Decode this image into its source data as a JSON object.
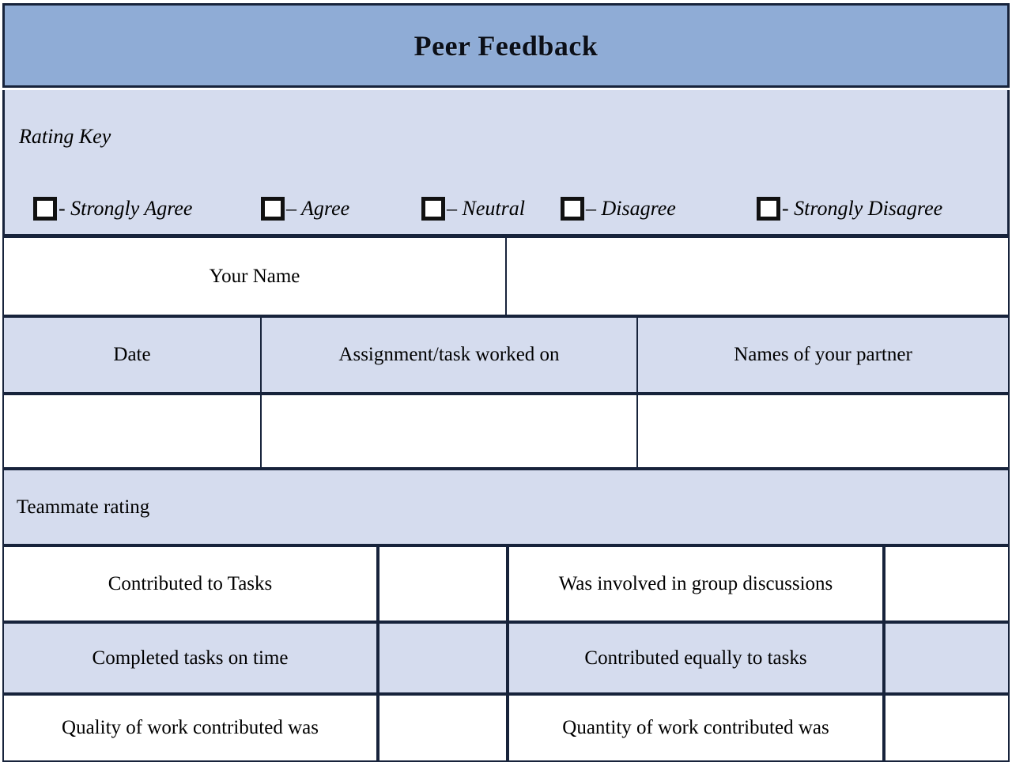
{
  "form": {
    "title": "Peer Feedback",
    "rating_key": {
      "heading": "Rating Key",
      "options": [
        {
          "checkbox": "checkbox-strongly-agree",
          "label": "- Strongly Agree"
        },
        {
          "checkbox": "checkbox-agree",
          "label": "– Agree"
        },
        {
          "checkbox": "checkbox-neutral",
          "label": "– Neutral"
        },
        {
          "checkbox": "checkbox-disagree",
          "label": "– Disagree"
        },
        {
          "checkbox": "checkbox-strongly-disagree",
          "label": "- Strongly Disagree"
        }
      ]
    },
    "info": {
      "your_name_label": "Your Name",
      "your_name_value": "",
      "date_label": "Date",
      "assignment_label": "Assignment/task worked on",
      "partner_label": "Names of your partner",
      "date_value": "",
      "assignment_value": "",
      "partner_value": ""
    },
    "teammate_rating": {
      "heading": "Teammate rating",
      "rows": [
        {
          "left_criterion": "Contributed to Tasks",
          "left_rating": "",
          "right_criterion": "Was involved in group discussions",
          "right_rating": ""
        },
        {
          "left_criterion": "Completed tasks on time",
          "left_rating": "",
          "right_criterion": "Contributed equally to tasks",
          "right_rating": ""
        },
        {
          "left_criterion": "Quality of work contributed was",
          "left_rating": "",
          "right_criterion": "Quantity of work contributed  was",
          "right_rating": ""
        }
      ]
    },
    "colors": {
      "title_banner": "#8FACD6",
      "shaded_row": "#D5DCEE",
      "border": "#17233B",
      "cell_background": "#FFFFFF"
    }
  }
}
